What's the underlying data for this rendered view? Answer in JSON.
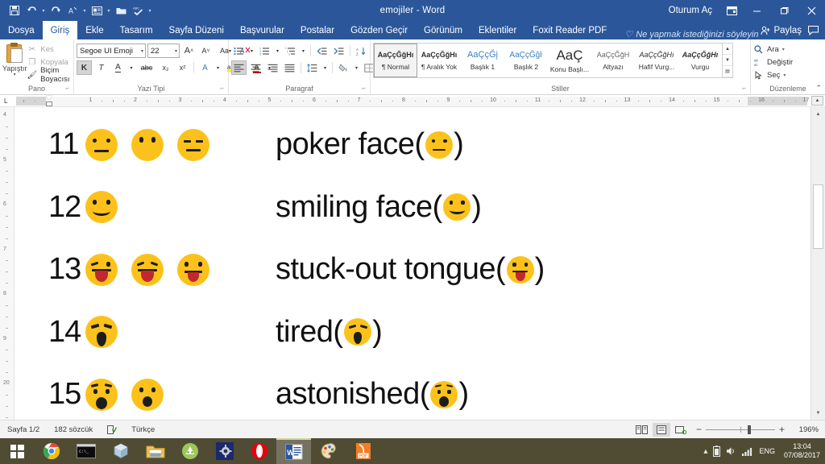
{
  "window": {
    "title": "emojiler  -  Word",
    "signin": "Oturum Aç",
    "ribbon_display_icon": "ribbon-display-options-icon",
    "minimize_icon": "minimize-icon",
    "restore_icon": "restore-icon",
    "close_icon": "close-icon"
  },
  "quick_access": [
    {
      "name": "save-icon",
      "glyph": "ὋE"
    },
    {
      "name": "undo-icon",
      "glyph": "↶"
    },
    {
      "name": "redo-icon",
      "glyph": "↻"
    },
    {
      "name": "font-color-icon",
      "glyph": "A"
    },
    {
      "name": "print-preview-icon",
      "glyph": "☰"
    },
    {
      "name": "open-icon",
      "glyph": "▰"
    },
    {
      "name": "spelling-check-icon",
      "glyph": "✓"
    },
    {
      "name": "customize-quick-access-icon",
      "glyph": "▾"
    }
  ],
  "tabs": [
    {
      "label": "Dosya",
      "active": false
    },
    {
      "label": "Giriş",
      "active": true
    },
    {
      "label": "Ekle",
      "active": false
    },
    {
      "label": "Tasarım",
      "active": false
    },
    {
      "label": "Sayfa Düzeni",
      "active": false
    },
    {
      "label": "Başvurular",
      "active": false
    },
    {
      "label": "Postalar",
      "active": false
    },
    {
      "label": "Gözden Geçir",
      "active": false
    },
    {
      "label": "Görünüm",
      "active": false
    },
    {
      "label": "Eklentiler",
      "active": false
    },
    {
      "label": "Foxit Reader PDF",
      "active": false
    }
  ],
  "tell_me": "Ne yapmak istediğinizi söyleyin",
  "share": "Paylaş",
  "comments_icon": "comments-icon",
  "ribbon": {
    "clipboard": {
      "label": "Pano",
      "paste": "Yapıştır",
      "cut": "Kes",
      "copy": "Kopyala",
      "format_painter": "Biçim Boyacısı"
    },
    "font": {
      "label": "Yazı Tipi",
      "font_name": "Segoe UI Emoji",
      "font_size": "22",
      "grow_font": "A",
      "shrink_font": "A",
      "change_case": "Aa",
      "clear_formatting_icon": "clear-formatting-icon",
      "bold": "K",
      "italic": "T",
      "underline": "A",
      "strikethrough": "abc",
      "subscript": "x₂",
      "superscript": "x²",
      "text_effects": "A",
      "highlight": "ab",
      "font_color": "A"
    },
    "paragraph": {
      "label": "Paragraf",
      "bullets_icon": "bullet-list-icon",
      "numbering_icon": "numbered-list-icon",
      "multilevel_icon": "multilevel-list-icon",
      "decrease_indent_icon": "decrease-indent-icon",
      "increase_indent_icon": "increase-indent-icon",
      "sort_icon": "sort-icon",
      "show_marks_icon": "paragraph-marks-icon",
      "align_left_icon": "align-left-icon",
      "align_center_icon": "align-center-icon",
      "align_right_icon": "align-right-icon",
      "justify_icon": "justify-icon",
      "line_spacing_icon": "line-spacing-icon",
      "shading_icon": "shading-icon",
      "borders_icon": "borders-icon"
    },
    "styles": {
      "label": "Stiller",
      "items": [
        {
          "preview": "AaÇçĞğHı",
          "name": "¶ Normal",
          "selected": true
        },
        {
          "preview": "AaÇçĞğHı",
          "name": "¶ Aralık Yok",
          "selected": false
        },
        {
          "preview": "AaÇçĞį",
          "name": "Başlık 1",
          "selected": false
        },
        {
          "preview": "AaÇçĞğŀ",
          "name": "Başlık 2",
          "selected": false
        },
        {
          "preview": "AaÇ",
          "name": "Konu Başlı...",
          "selected": false
        },
        {
          "preview": "AaÇçĞğH",
          "name": "Altyazı",
          "selected": false
        },
        {
          "preview": "AaÇçĞğHı",
          "name": "Hafif Vurg...",
          "selected": false
        },
        {
          "preview": "AaÇçĞğHı",
          "name": "Vurgu",
          "selected": false
        }
      ]
    },
    "editing": {
      "label": "Düzenleme",
      "find": "Ara",
      "replace": "Değiştir",
      "select": "Seç"
    },
    "collapse_icon": "collapse-ribbon-icon"
  },
  "ruler": {
    "tab_stop_marker": "L",
    "numbers": [
      1,
      2,
      3,
      4,
      5,
      6,
      7,
      8,
      9,
      10,
      11,
      12,
      13,
      14,
      15,
      16,
      17
    ],
    "scroll_up_icon": "scroll-up-icon"
  },
  "vertical_ruler_numbers": [
    4,
    5,
    6,
    7,
    8,
    9,
    20
  ],
  "document": {
    "rows": [
      {
        "number": "11",
        "emojis": [
          "neutral-face",
          "face-without-mouth",
          "expressionless-face"
        ],
        "label": "poker face",
        "inline_emoji": "neutral-face"
      },
      {
        "number": "12",
        "emojis": [
          "slightly-smiling-face"
        ],
        "label": "smiling face",
        "inline_emoji": "slightly-smiling-face"
      },
      {
        "number": "13",
        "emojis": [
          "winking-face-with-tongue",
          "squinting-face-with-tongue",
          "face-with-tongue"
        ],
        "label": "stuck-out tongue",
        "inline_emoji": "face-with-tongue"
      },
      {
        "number": "14",
        "emojis": [
          "tired-face"
        ],
        "label": "tired",
        "inline_emoji": "tired-face"
      },
      {
        "number": "15",
        "emojis": [
          "astonished-face",
          "face-with-open-mouth"
        ],
        "label": "astonished",
        "inline_emoji": "astonished-face"
      }
    ],
    "open_paren": "(",
    "close_paren": ")"
  },
  "status_bar": {
    "page": "Sayfa 1/2",
    "words": "182 sözcük",
    "proofing_icon": "proofing-errors-icon",
    "language": "Türkçe",
    "view_read_icon": "read-mode-icon",
    "view_print_icon": "print-layout-icon",
    "view_web_icon": "web-layout-icon",
    "zoom_out": "−",
    "zoom_in": "+",
    "zoom_level": "196%"
  },
  "taskbar": {
    "start_icon": "windows-start-icon",
    "apps": [
      {
        "name": "chrome-icon"
      },
      {
        "name": "command-prompt-icon"
      },
      {
        "name": "virtualbox-icon"
      },
      {
        "name": "file-explorer-icon"
      },
      {
        "name": "android-studio-icon"
      },
      {
        "name": "settings-app-icon"
      },
      {
        "name": "opera-icon"
      },
      {
        "name": "word-icon",
        "active": true
      },
      {
        "name": "paint-icon"
      },
      {
        "name": "foxit-pdf-icon"
      }
    ],
    "tray": {
      "show_hidden_icon": "show-hidden-icons-icon",
      "battery_icon": "battery-icon",
      "volume_icon": "volume-icon",
      "network_icon": "network-signal-icon",
      "language": "ENG",
      "time": "13:04",
      "date": "07/08/2017"
    }
  },
  "colors": {
    "word_blue": "#2b579a",
    "emoji_yellow": "#fcc21b",
    "tongue_red": "#c1272d",
    "taskbar": "#4f4c33",
    "doc_background": "#868686"
  }
}
